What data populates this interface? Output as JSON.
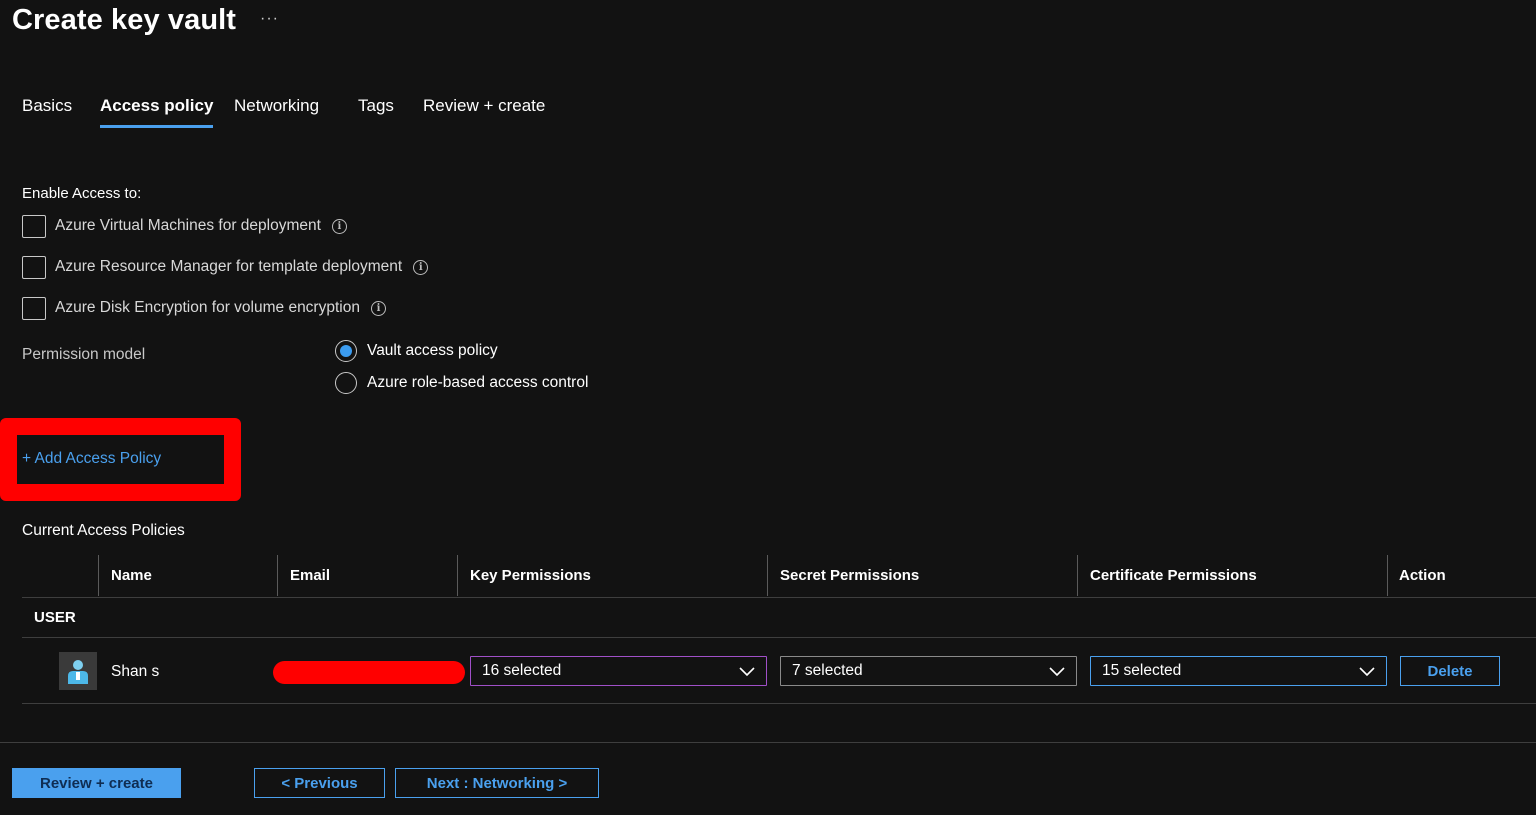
{
  "header": {
    "title": "Create key vault",
    "more": "···"
  },
  "tabs": [
    {
      "label": "Basics",
      "active": false
    },
    {
      "label": "Access policy",
      "active": true
    },
    {
      "label": "Networking",
      "active": false
    },
    {
      "label": "Tags",
      "active": false
    },
    {
      "label": "Review + create",
      "active": false
    }
  ],
  "enable_access": {
    "label": "Enable Access to:",
    "options": [
      {
        "label": "Azure Virtual Machines for deployment",
        "checked": false
      },
      {
        "label": "Azure Resource Manager for template deployment",
        "checked": false
      },
      {
        "label": "Azure Disk Encryption for volume encryption",
        "checked": false
      }
    ],
    "info_glyph": "i"
  },
  "permission_model": {
    "label": "Permission model",
    "options": [
      {
        "label": "Vault access policy",
        "selected": true
      },
      {
        "label": "Azure role-based access control",
        "selected": false
      }
    ]
  },
  "add_policy": {
    "label": "+ Add Access Policy",
    "highlight_color": "#ff0000"
  },
  "policies": {
    "label": "Current Access Policies",
    "columns": [
      "Name",
      "Email",
      "Key Permissions",
      "Secret Permissions",
      "Certificate Permissions",
      "Action"
    ],
    "group": "USER",
    "rows": [
      {
        "name": "Shan s",
        "email_redacted": true,
        "key_permissions": "16 selected",
        "secret_permissions": "7 selected",
        "certificate_permissions": "15 selected",
        "action": "Delete"
      }
    ]
  },
  "footer": {
    "review_create": "Review + create",
    "previous": "< Previous",
    "next": "Next : Networking >"
  },
  "colors": {
    "background": "#121212",
    "accent": "#4aa0ee",
    "redaction": "#ff0000"
  }
}
